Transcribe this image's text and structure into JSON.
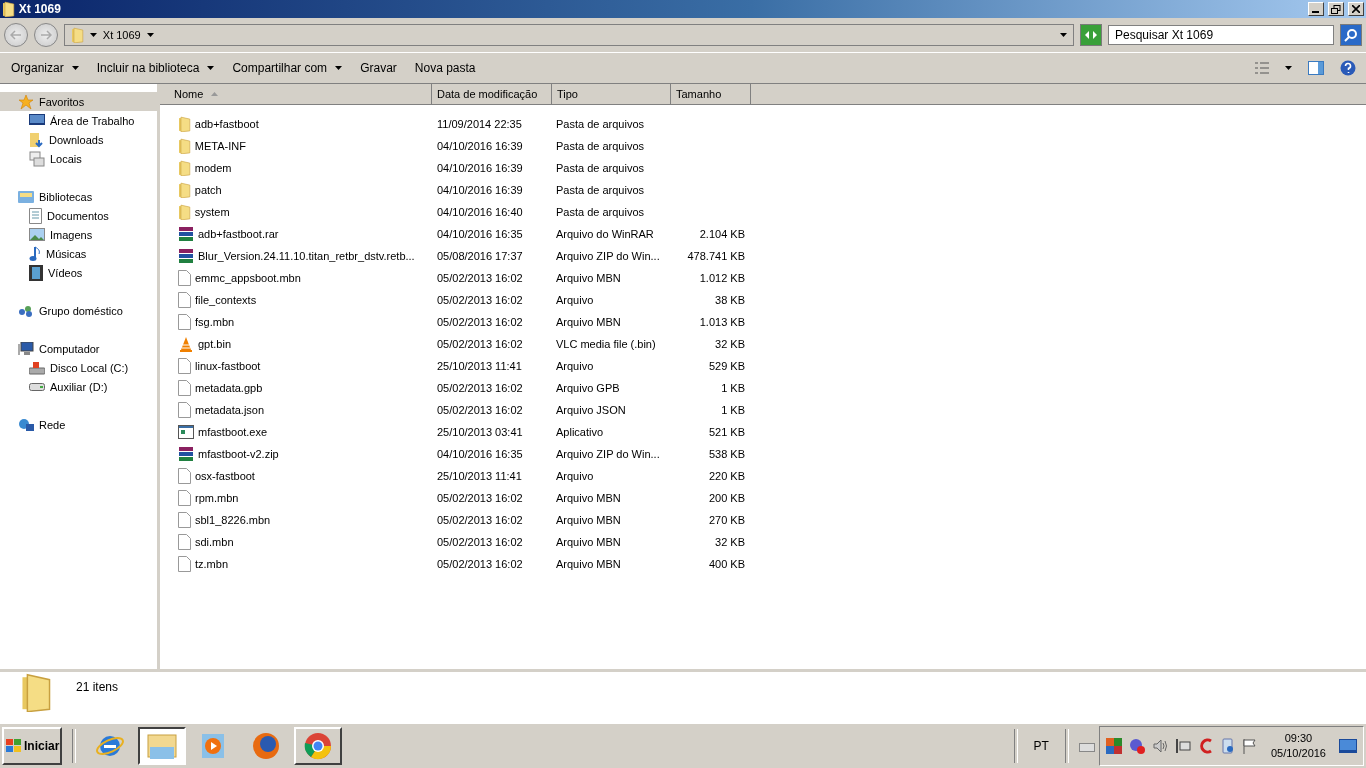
{
  "window": {
    "title": "Xt 1069"
  },
  "address_bar": {
    "path": "Xt 1069",
    "search_placeholder": "Pesquisar Xt 1069"
  },
  "command_bar": [
    {
      "label": "Organizar",
      "dropdown": true
    },
    {
      "label": "Incluir na biblioteca",
      "dropdown": true
    },
    {
      "label": "Compartilhar com",
      "dropdown": true
    },
    {
      "label": "Gravar",
      "dropdown": false
    },
    {
      "label": "Nova pasta",
      "dropdown": false
    }
  ],
  "sidebar": [
    {
      "label": "Favoritos",
      "selected": true,
      "children": [
        {
          "label": "Área de Trabalho",
          "selected": false
        },
        {
          "label": "Downloads",
          "selected": false
        },
        {
          "label": "Locais",
          "selected": false
        }
      ]
    },
    {
      "label": "Bibliotecas",
      "selected": false,
      "children": [
        {
          "label": "Documentos",
          "selected": false
        },
        {
          "label": "Imagens",
          "selected": false
        },
        {
          "label": "Músicas",
          "selected": false
        },
        {
          "label": "Vídeos",
          "selected": false
        }
      ]
    },
    {
      "label": "Grupo doméstico",
      "selected": false
    },
    {
      "label": "Computador",
      "selected": false,
      "children": [
        {
          "label": "Disco Local (C:)",
          "selected": false
        },
        {
          "label": "Auxiliar (D:)",
          "selected": false
        }
      ]
    },
    {
      "label": "Rede",
      "selected": false
    }
  ],
  "table": {
    "columns": [
      "Nome",
      "Data de modificação",
      "Tipo",
      "Tamanho"
    ],
    "rows": [
      {
        "kind": "folder",
        "name": "adb+fastboot",
        "date": "11/09/2014 22:35",
        "type": "Pasta de arquivos"
      },
      {
        "kind": "folder",
        "name": "META-INF",
        "date": "04/10/2016 16:39",
        "type": "Pasta de arquivos"
      },
      {
        "kind": "folder",
        "name": "modem",
        "date": "04/10/2016 16:39",
        "type": "Pasta de arquivos"
      },
      {
        "kind": "folder",
        "name": "patch",
        "date": "04/10/2016 16:39",
        "type": "Pasta de arquivos"
      },
      {
        "kind": "folder",
        "name": "system",
        "date": "04/10/2016 16:40",
        "type": "Pasta de arquivos"
      },
      {
        "kind": "archive",
        "name": "adb+fastboot.rar",
        "date": "04/10/2016 16:35",
        "type": "Arquivo do WinRAR",
        "size": "2.104 KB"
      },
      {
        "kind": "archive",
        "name": "Blur_Version.24.11.10.titan_retbr_dstv.retb...",
        "date": "05/08/2016 17:37",
        "type": "Arquivo ZIP do Win...",
        "size": "478.741 KB"
      },
      {
        "kind": "file",
        "name": "emmc_appsboot.mbn",
        "date": "05/02/2013 16:02",
        "type": "Arquivo MBN",
        "size": "1.012 KB"
      },
      {
        "kind": "file",
        "name": "file_contexts",
        "date": "05/02/2013 16:02",
        "type": "Arquivo",
        "size": "38 KB"
      },
      {
        "kind": "file",
        "name": "fsg.mbn",
        "date": "05/02/2013 16:02",
        "type": "Arquivo MBN",
        "size": "1.013 KB"
      },
      {
        "kind": "media",
        "name": "gpt.bin",
        "date": "05/02/2013 16:02",
        "type": "VLC media file (.bin)",
        "size": "32 KB"
      },
      {
        "kind": "file",
        "name": "linux-fastboot",
        "date": "25/10/2013 11:41",
        "type": "Arquivo",
        "size": "529 KB"
      },
      {
        "kind": "file",
        "name": "metadata.gpb",
        "date": "05/02/2013 16:02",
        "type": "Arquivo GPB",
        "size": "1 KB"
      },
      {
        "kind": "file",
        "name": "metadata.json",
        "date": "05/02/2013 16:02",
        "type": "Arquivo JSON",
        "size": "1 KB"
      },
      {
        "kind": "app",
        "name": "mfastboot.exe",
        "date": "25/10/2013 03:41",
        "type": "Aplicativo",
        "size": "521 KB"
      },
      {
        "kind": "archive",
        "name": "mfastboot-v2.zip",
        "date": "04/10/2016 16:35",
        "type": "Arquivo ZIP do Win...",
        "size": "538 KB"
      },
      {
        "kind": "file",
        "name": "osx-fastboot",
        "date": "25/10/2013 11:41",
        "type": "Arquivo",
        "size": "220 KB"
      },
      {
        "kind": "file",
        "name": "rpm.mbn",
        "date": "05/02/2013 16:02",
        "type": "Arquivo MBN",
        "size": "200 KB"
      },
      {
        "kind": "file",
        "name": "sbl1_8226.mbn",
        "date": "05/02/2013 16:02",
        "type": "Arquivo MBN",
        "size": "270 KB"
      },
      {
        "kind": "file",
        "name": "sdi.mbn",
        "date": "05/02/2013 16:02",
        "type": "Arquivo MBN",
        "size": "32 KB"
      },
      {
        "kind": "file",
        "name": "tz.mbn",
        "date": "05/02/2013 16:02",
        "type": "Arquivo MBN",
        "size": "400 KB"
      }
    ]
  },
  "details": {
    "count": "21 itens"
  },
  "taskbar": {
    "start": "Iniciar",
    "apps": [
      {
        "open": false,
        "selected": false
      },
      {
        "open": true,
        "selected": true
      },
      {
        "open": false,
        "selected": false
      },
      {
        "open": false,
        "selected": false
      },
      {
        "open": true,
        "selected": false
      }
    ],
    "language": "PT",
    "time": "09:30",
    "date": "05/10/2016"
  }
}
